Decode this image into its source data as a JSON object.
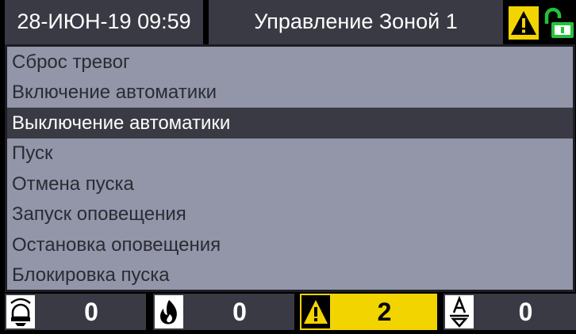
{
  "header": {
    "datetime": "28-ИЮН-19 09:59",
    "title": "Управление Зоной 1",
    "warning_icon": "warning-triangle-icon",
    "lock_icon": "unlocked-padlock-icon"
  },
  "menu": {
    "items": [
      {
        "label": "Сброс тревог",
        "selected": false
      },
      {
        "label": "Включение автоматики",
        "selected": false
      },
      {
        "label": "Выключение автоматики",
        "selected": true
      },
      {
        "label": "Пуск",
        "selected": false
      },
      {
        "label": "Отмена пуска",
        "selected": false
      },
      {
        "label": "Запуск оповещения",
        "selected": false
      },
      {
        "label": "Остановка оповещения",
        "selected": false
      },
      {
        "label": "Блокировка пуска",
        "selected": false
      }
    ]
  },
  "counters": [
    {
      "icon": "siren-icon",
      "value": "0",
      "highlighted": false
    },
    {
      "icon": "fire-icon",
      "value": "0",
      "highlighted": false
    },
    {
      "icon": "warning-triangle-icon",
      "value": "2",
      "highlighted": true
    },
    {
      "icon": "automatic-mode-icon",
      "value": "0",
      "highlighted": false
    }
  ],
  "colors": {
    "panel": "#3a3a44",
    "menu_background": "#9296a8",
    "warning_yellow": "#f2d400",
    "unlock_green": "#23c23e"
  }
}
